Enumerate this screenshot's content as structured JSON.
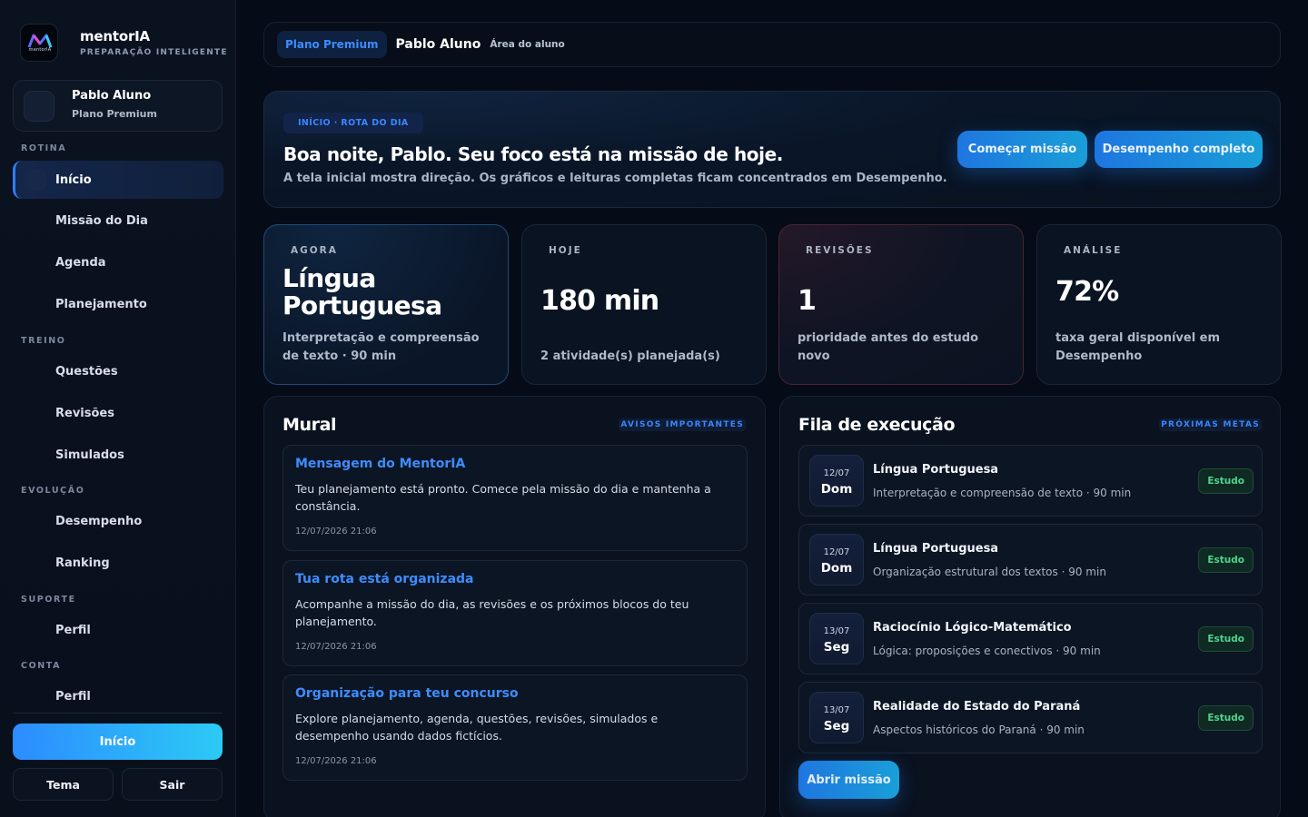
{
  "brand": {
    "name": "mentorIA",
    "tagline": "PREPARAÇÃO INTELIGENTE",
    "logo_small_text": "mentorIA"
  },
  "user": {
    "name": "Pablo Aluno",
    "plan": "Plano Premium"
  },
  "sidebar": {
    "sections": [
      {
        "label": "ROTINA",
        "items": [
          "Início",
          "Missão do Dia",
          "Agenda",
          "Planejamento"
        ]
      },
      {
        "label": "TREINO",
        "items": [
          "Questões",
          "Revisões",
          "Simulados"
        ]
      },
      {
        "label": "EVOLUÇÃO",
        "items": [
          "Desempenho",
          "Ranking"
        ]
      },
      {
        "label": "SUPORTE",
        "items": [
          "Perfil"
        ]
      },
      {
        "label": "CONTA",
        "items": [
          "Perfil"
        ]
      }
    ],
    "active_item": "Início",
    "home_button": "Início",
    "theme_button": "Tema",
    "logout_button": "Sair"
  },
  "topbar": {
    "plan": "Plano Premium",
    "name": "Pablo Aluno",
    "area": "Área do aluno"
  },
  "hero": {
    "tag": "INÍCIO · ROTA DO DIA",
    "title": "Boa noite, Pablo. Seu foco está na missão de hoje.",
    "subtitle": "A tela inicial mostra direção. Os gráficos e leituras completas ficam concentrados em Desempenho.",
    "primary_button": "Começar missão",
    "secondary_button": "Desempenho completo"
  },
  "stats": [
    {
      "label": "AGORA",
      "value": "Língua Portuguesa",
      "desc": "Interpretação e compreensão de texto · 90 min"
    },
    {
      "label": "HOJE",
      "value": "180 min",
      "desc": "2 atividade(s) planejada(s)"
    },
    {
      "label": "REVISÕES",
      "value": "1",
      "desc": "prioridade antes do estudo novo"
    },
    {
      "label": "ANÁLISE",
      "value": "72%",
      "desc": "taxa geral disponível em Desempenho"
    }
  ],
  "mural": {
    "title": "Mural",
    "badge": "AVISOS IMPORTANTES",
    "messages": [
      {
        "title": "Mensagem do MentorIA",
        "text": "Teu planejamento está pronto. Comece pela missão do dia e mantenha a constância.",
        "date": "12/07/2026 21:06"
      },
      {
        "title": "Tua rota está organizada",
        "text": "Acompanhe a missão do dia, as revisões e os próximos blocos do teu planejamento.",
        "date": "12/07/2026 21:06"
      },
      {
        "title": "Organização para teu concurso",
        "text": "Explore planejamento, agenda, questões, revisões, simulados e desempenho usando dados fictícios.",
        "date": "12/07/2026 21:06"
      }
    ]
  },
  "queue": {
    "title": "Fila de execução",
    "badge": "PRÓXIMAS METAS",
    "items": [
      {
        "date": "12/07",
        "weekday": "Dom",
        "title": "Língua Portuguesa",
        "subtitle": "Interpretação e compreensão de texto · 90 min",
        "tag": "Estudo"
      },
      {
        "date": "12/07",
        "weekday": "Dom",
        "title": "Língua Portuguesa",
        "subtitle": "Organização estrutural dos textos · 90 min",
        "tag": "Estudo"
      },
      {
        "date": "13/07",
        "weekday": "Seg",
        "title": "Raciocínio Lógico-Matemático",
        "subtitle": "Lógica: proposições e conectivos · 90 min",
        "tag": "Estudo"
      },
      {
        "date": "13/07",
        "weekday": "Seg",
        "title": "Realidade do Estado do Paraná",
        "subtitle": "Aspectos históricos do Paraná · 90 min",
        "tag": "Estudo"
      }
    ],
    "open_button": "Abrir missão"
  }
}
